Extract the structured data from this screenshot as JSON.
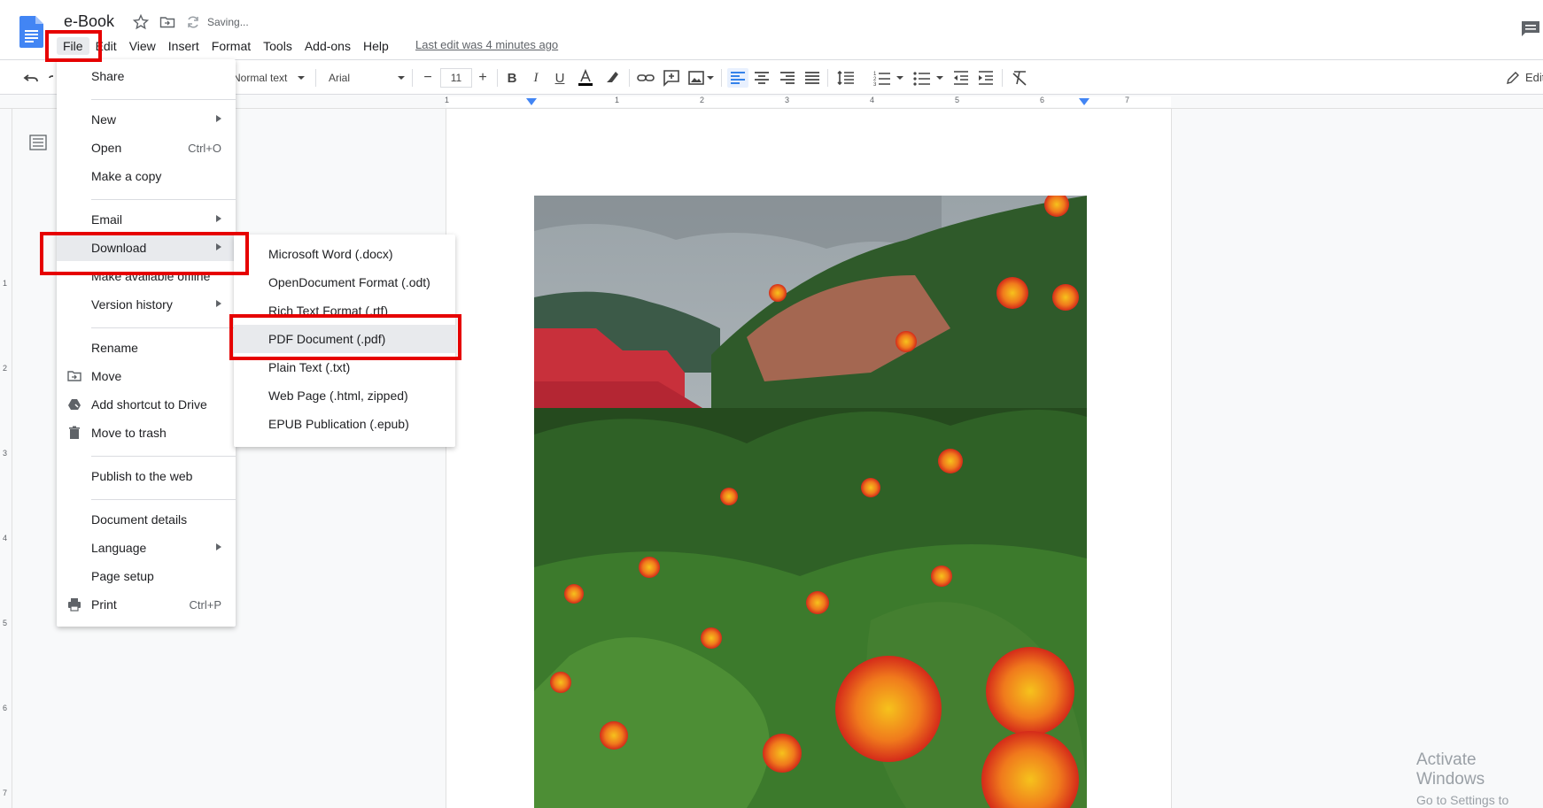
{
  "header": {
    "title": "e-Book",
    "saving": "Saving...",
    "last_edit": "Last edit was 4 minutes ago",
    "menus": [
      "File",
      "Edit",
      "View",
      "Insert",
      "Format",
      "Tools",
      "Add-ons",
      "Help"
    ]
  },
  "toolbar": {
    "style": "Normal text",
    "font": "Arial",
    "font_size": "11",
    "edit_mode": "Editing"
  },
  "ruler": [
    "1",
    "1",
    "2",
    "3",
    "4",
    "5",
    "6",
    "7"
  ],
  "vruler": [
    "1",
    "2",
    "3",
    "4",
    "5",
    "6",
    "7"
  ],
  "file_menu": {
    "share": "Share",
    "new": "New",
    "open": "Open",
    "open_shortcut": "Ctrl+O",
    "make_copy": "Make a copy",
    "email": "Email",
    "download": "Download",
    "offline": "Make available offline",
    "version_history": "Version history",
    "rename": "Rename",
    "move": "Move",
    "add_shortcut": "Add shortcut to Drive",
    "trash": "Move to trash",
    "publish": "Publish to the web",
    "details": "Document details",
    "language": "Language",
    "page_setup": "Page setup",
    "print": "Print",
    "print_shortcut": "Ctrl+P"
  },
  "download_menu": {
    "items": [
      "Microsoft Word (.docx)",
      "OpenDocument Format (.odt)",
      "Rich Text Format (.rtf)",
      "PDF Document (.pdf)",
      "Plain Text (.txt)",
      "Web Page (.html, zipped)",
      "EPUB Publication (.epub)"
    ]
  },
  "watermark": {
    "line1": "Activate Windows",
    "line2": "Go to Settings to activate Windows."
  },
  "colors": {
    "highlight": "#e60000",
    "accent": "#4285f4",
    "doc_blue": "#4285f4"
  }
}
